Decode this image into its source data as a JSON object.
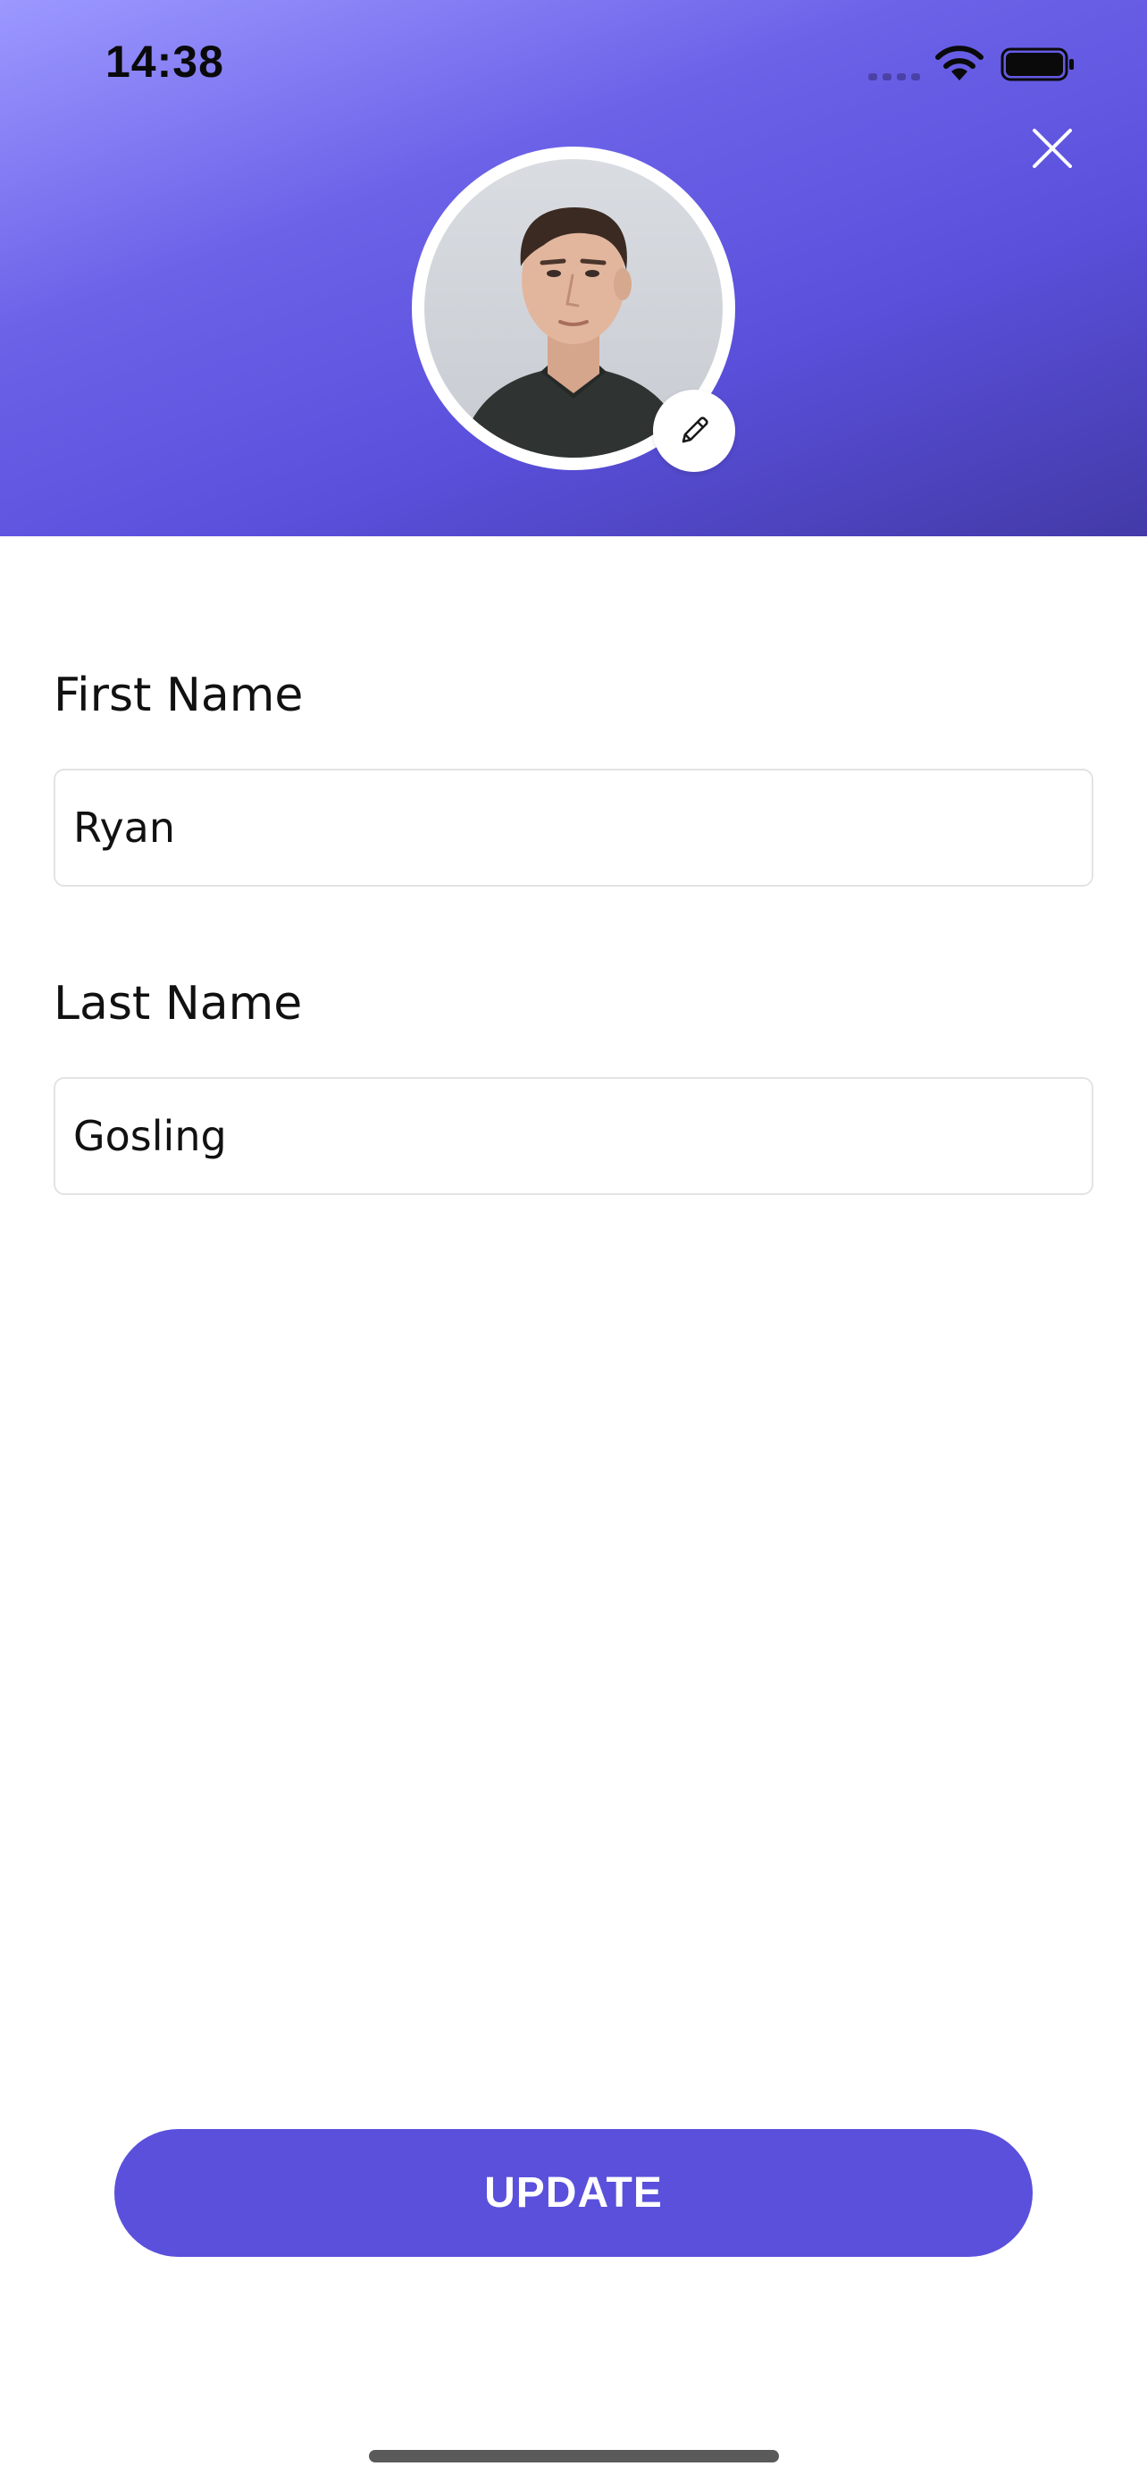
{
  "status_bar": {
    "time": "14:38"
  },
  "header": {
    "close_icon": "close-icon",
    "edit_icon": "pencil-icon"
  },
  "form": {
    "first_name": {
      "label": "First Name",
      "value": "Ryan"
    },
    "last_name": {
      "label": "Last Name",
      "value": "Gosling"
    }
  },
  "actions": {
    "update_label": "UPDATE"
  },
  "colors": {
    "accent": "#5a50dc",
    "header_gradient_start": "#9c98ff",
    "header_gradient_end": "#433aa8"
  }
}
